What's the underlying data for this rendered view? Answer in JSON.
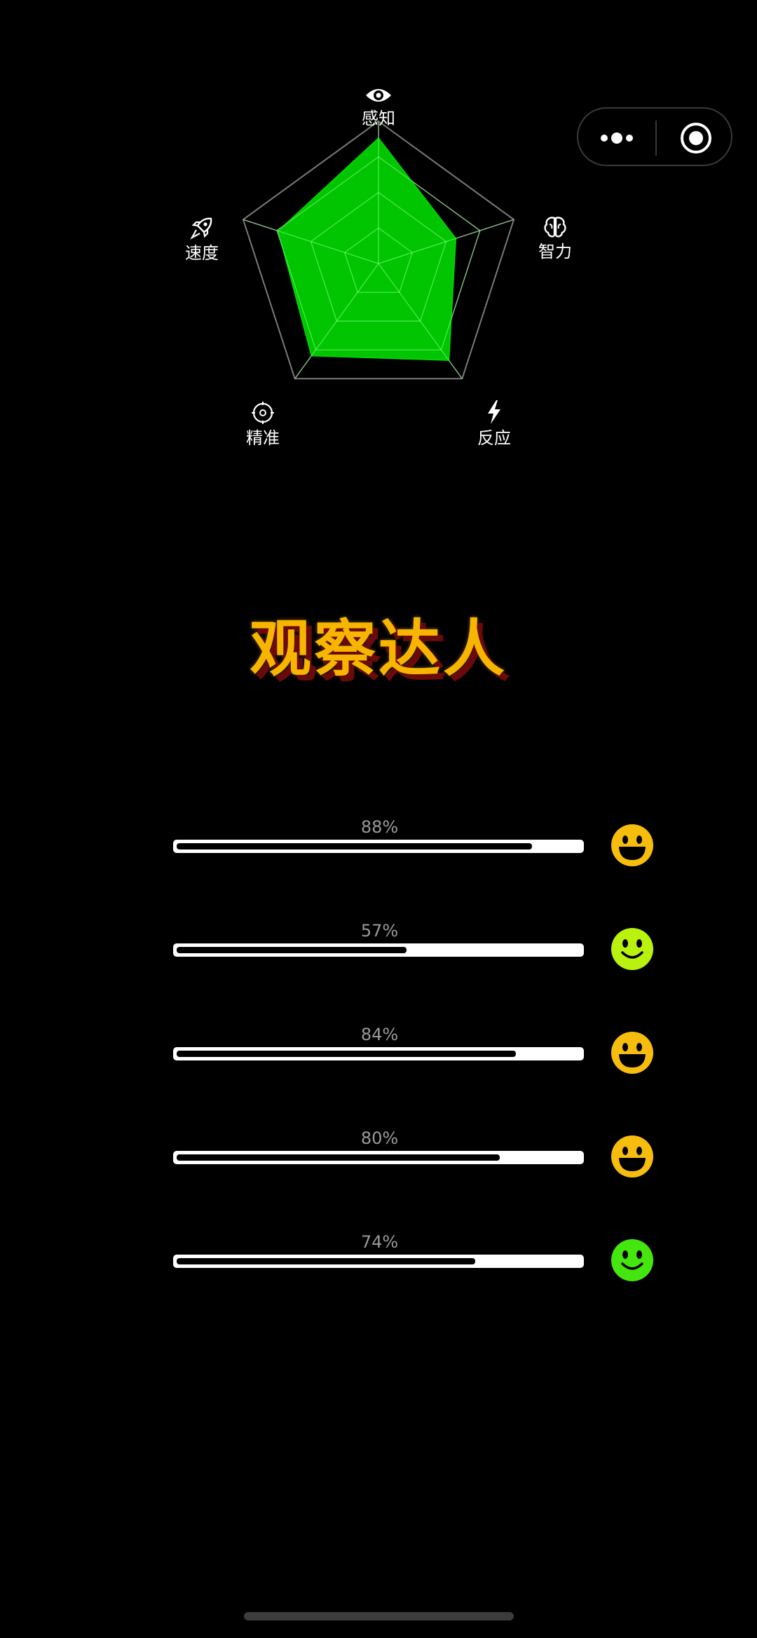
{
  "colors": {
    "background": "#000000",
    "radar_fill": "#00d400",
    "title": "#f7b500",
    "title_shadow": "#6a0a0a",
    "face_laugh": "#f7bd0e",
    "face_smile_lime": "#b9f20f",
    "face_smile_green": "#45e60f"
  },
  "radar": {
    "axes": [
      {
        "label": "感知",
        "icon": "eye-icon",
        "value": 0.88
      },
      {
        "label": "智力",
        "icon": "brain-icon",
        "value": 0.57
      },
      {
        "label": "反应",
        "icon": "lightning-icon",
        "value": 0.84
      },
      {
        "label": "精准",
        "icon": "target-icon",
        "value": 0.8
      },
      {
        "label": "速度",
        "icon": "rocket-icon",
        "value": 0.74
      }
    ],
    "levels": 4
  },
  "title": "观察达人",
  "bars": [
    {
      "percent_text": "88%",
      "value": 0.88,
      "face": "laughing-face-icon",
      "face_color": "#f7bd0e"
    },
    {
      "percent_text": "57%",
      "value": 0.57,
      "face": "smiling-face-icon",
      "face_color": "#b9f20f"
    },
    {
      "percent_text": "84%",
      "value": 0.84,
      "face": "laughing-face-icon",
      "face_color": "#f7bd0e"
    },
    {
      "percent_text": "80%",
      "value": 0.8,
      "face": "laughing-face-icon",
      "face_color": "#f7bd0e"
    },
    {
      "percent_text": "74%",
      "value": 0.74,
      "face": "smiling-face-icon",
      "face_color": "#45e60f"
    }
  ],
  "capsule": {
    "more_icon": "more-dots-icon",
    "close_icon": "close-target-icon"
  }
}
